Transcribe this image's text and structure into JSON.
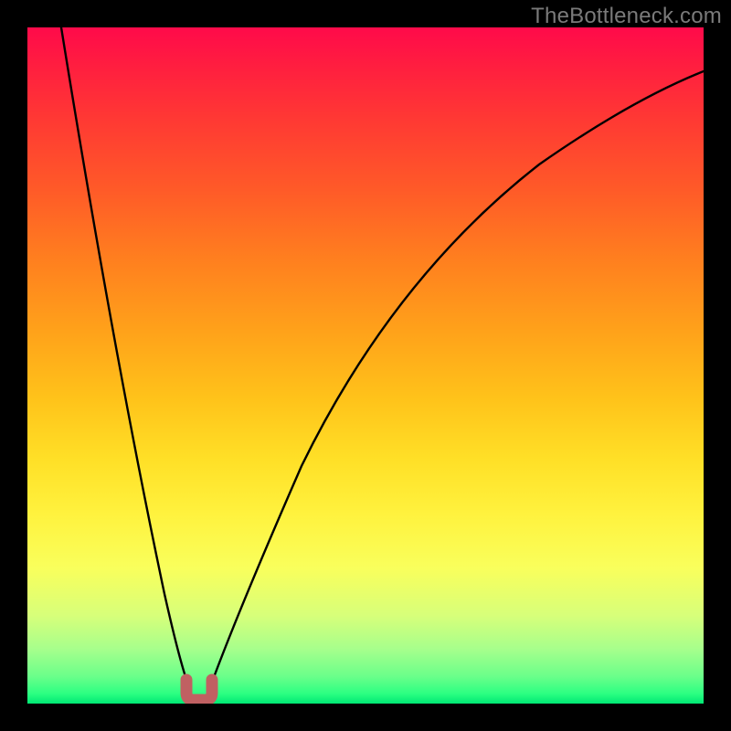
{
  "watermark": "TheBottleneck.com",
  "chart_data": {
    "type": "line",
    "title": "",
    "xlabel": "",
    "ylabel": "",
    "xlim": [
      0,
      100
    ],
    "ylim": [
      0,
      100
    ],
    "grid": false,
    "legend": false,
    "note": "Implicit bottleneck-percentage curve; bottom=green (good), top=red (bad). Minimum near x≈24.",
    "series": [
      {
        "name": "bottleneck-curve",
        "x": [
          5,
          8,
          11,
          14,
          17,
          20,
          22,
          23,
          24,
          25,
          26,
          28,
          31,
          35,
          40,
          46,
          53,
          61,
          70,
          80,
          90,
          100
        ],
        "y": [
          100,
          84,
          68,
          52,
          37,
          20,
          8,
          2,
          0,
          0,
          2,
          10,
          22,
          35,
          48,
          59,
          68,
          76,
          82,
          88,
          92,
          95
        ]
      },
      {
        "name": "minimum-marker",
        "x": [
          23,
          24,
          25,
          26
        ],
        "y": [
          2,
          0,
          0,
          2
        ]
      }
    ]
  },
  "colors": {
    "curve": "#000000",
    "marker": "#c06062",
    "background_top": "#ff0a4a",
    "background_bottom": "#00e874"
  }
}
